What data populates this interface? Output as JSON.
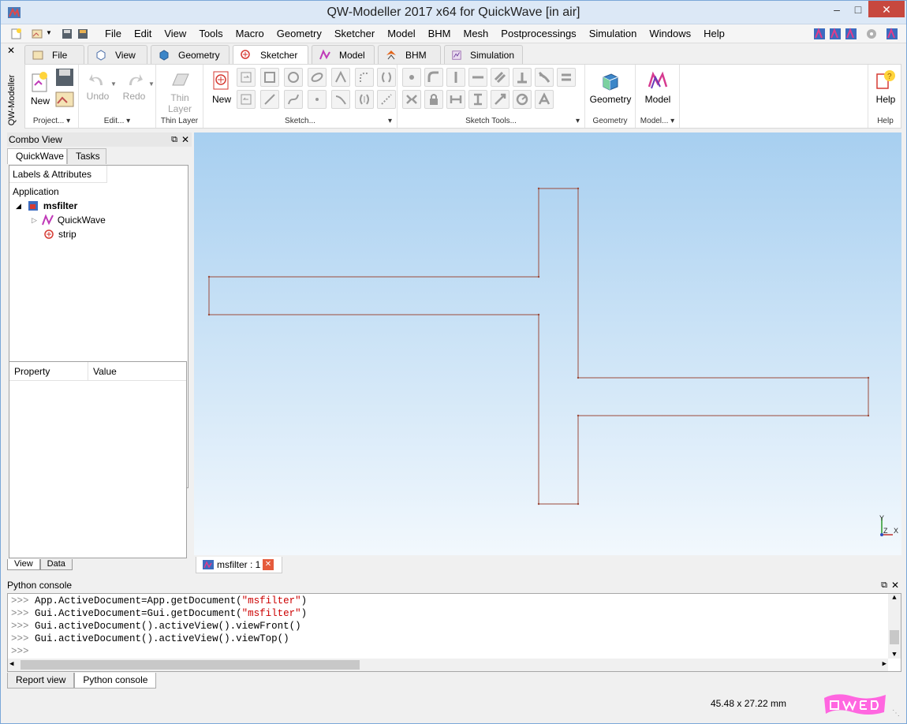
{
  "window": {
    "title": "QW-Modeller 2017 x64 for QuickWave [in air]"
  },
  "menubar": {
    "items": [
      "File",
      "Edit",
      "View",
      "Tools",
      "Macro",
      "Geometry",
      "Sketcher",
      "Model",
      "BHM",
      "Mesh",
      "Postprocessings",
      "Simulation",
      "Windows",
      "Help"
    ]
  },
  "sidebar_caption": "QW-Modeller",
  "ribbon": {
    "tabs": [
      "File",
      "View",
      "Geometry",
      "Sketcher",
      "Model",
      "BHM",
      "Simulation"
    ],
    "active_tab": "Sketcher",
    "groups": {
      "project": {
        "label": "Project...",
        "new": "New"
      },
      "edit": {
        "label": "Edit...",
        "undo": "Undo",
        "redo": "Redo"
      },
      "thin_layer": {
        "label": "Thin Layer",
        "btn": "Thin Layer"
      },
      "sketch": {
        "label": "Sketch...",
        "new": "New"
      },
      "sketch_tools": {
        "label": "Sketch Tools..."
      },
      "geometry": {
        "label": "Geometry",
        "btn": "Geometry"
      },
      "model": {
        "label": "Model...",
        "btn": "Model"
      },
      "help": {
        "label": "Help",
        "btn": "Help"
      }
    }
  },
  "combo": {
    "title": "Combo View",
    "tabs": [
      "QuickWave",
      "Tasks"
    ],
    "tree_header": "Labels & Attributes",
    "application": "Application",
    "doc": "msfilter",
    "children": [
      "QuickWave",
      "strip"
    ],
    "prop_headers": [
      "Property",
      "Value"
    ],
    "bottom_tabs": [
      "View",
      "Data"
    ]
  },
  "view_tab": "msfilter : 1",
  "axis_labels": {
    "y": "Y",
    "z": "Z",
    "x": "X"
  },
  "console": {
    "title": "Python console",
    "prompt": ">>>",
    "lines": [
      {
        "a": "App.ActiveDocument=App.getDocument(",
        "s": "\"msfilter\"",
        "b": ")"
      },
      {
        "a": "Gui.ActiveDocument=Gui.getDocument(",
        "s": "\"msfilter\"",
        "b": ")"
      },
      {
        "a": "Gui.activeDocument().activeView().viewFront()",
        "s": "",
        "b": ""
      },
      {
        "a": "Gui.activeDocument().activeView().viewTop()",
        "s": "",
        "b": ""
      }
    ]
  },
  "bottom_tabs": [
    "Report view",
    "Python console"
  ],
  "active_bottom_tab": "Python console",
  "status": {
    "coords": "45.48 x 27.22 mm"
  },
  "colors": {
    "sketch_line": "#9c4a3a",
    "accent": "#d63a32"
  }
}
